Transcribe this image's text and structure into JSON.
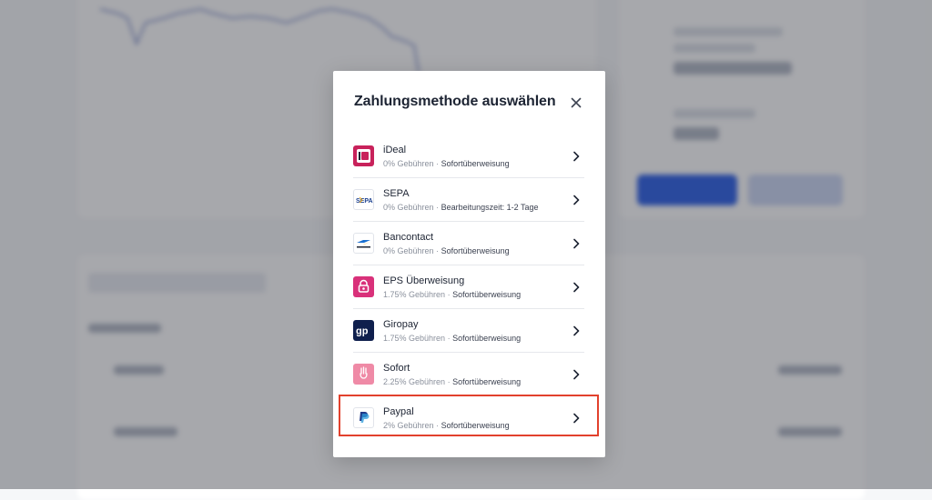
{
  "modal": {
    "title": "Zahlungsmethode auswählen",
    "close_icon": "close-icon"
  },
  "payment_methods": [
    {
      "name": "iDeal",
      "fee": "0% Gebühren",
      "separator": "·",
      "speed": "Sofortüberweisung",
      "icon": "ideal-logo",
      "color": "#c8225b"
    },
    {
      "name": "SEPA",
      "fee": "0% Gebühren",
      "separator": "·",
      "speed": "Bearbeitungszeit: 1-2 Tage",
      "icon": "sepa-logo",
      "color": "#1a3f8f"
    },
    {
      "name": "Bancontact",
      "fee": "0% Gebühren",
      "separator": "·",
      "speed": "Sofortüberweisung",
      "icon": "bancontact-logo",
      "color": "#f2b01e"
    },
    {
      "name": "EPS Überweisung",
      "fee": "1.75% Gebühren",
      "separator": "·",
      "speed": "Sofortüberweisung",
      "icon": "eps-logo",
      "color": "#d9317a"
    },
    {
      "name": "Giropay",
      "fee": "1.75% Gebühren",
      "separator": "·",
      "speed": "Sofortüberweisung",
      "icon": "giropay-logo",
      "color": "#0f1f4d"
    },
    {
      "name": "Sofort",
      "fee": "2.25% Gebühren",
      "separator": "·",
      "speed": "Sofortüberweisung",
      "icon": "sofort-logo",
      "color": "#ef8aa6"
    },
    {
      "name": "Paypal",
      "fee": "2% Gebühren",
      "separator": "·",
      "speed": "Sofortüberweisung",
      "icon": "paypal-logo",
      "color": "#1f3a8a"
    }
  ],
  "highlighted_method": "Paypal"
}
